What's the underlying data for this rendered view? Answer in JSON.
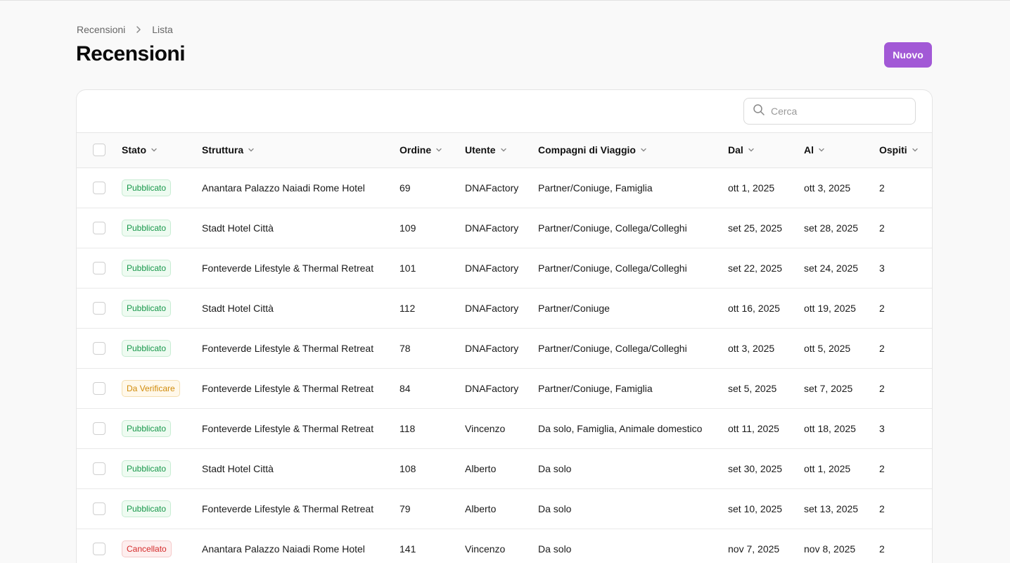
{
  "breadcrumb": {
    "root": "Recensioni",
    "current": "Lista"
  },
  "page": {
    "title": "Recensioni",
    "new_button": "Nuovo"
  },
  "search": {
    "placeholder": "Cerca"
  },
  "colors": {
    "accent": "#a259d6",
    "published": "#17974a",
    "pending": "#d08a0a",
    "cancelled": "#d42a2a"
  },
  "columns": {
    "stato": "Stato",
    "struttura": "Struttura",
    "ordine": "Ordine",
    "utente": "Utente",
    "compagni": "Compagni di Viaggio",
    "dal": "Dal",
    "al": "Al",
    "ospiti": "Ospiti"
  },
  "rows": [
    {
      "stato": "Pubblicato",
      "status": "green",
      "struttura": "Anantara Palazzo Naiadi Rome Hotel",
      "ordine": "69",
      "utente": "DNAFactory",
      "compagni": "Partner/Coniuge, Famiglia",
      "dal": "ott 1, 2025",
      "al": "ott 3, 2025",
      "ospiti": "2"
    },
    {
      "stato": "Pubblicato",
      "status": "green",
      "struttura": "Stadt Hotel Città",
      "ordine": "109",
      "utente": "DNAFactory",
      "compagni": "Partner/Coniuge, Collega/Colleghi",
      "dal": "set 25, 2025",
      "al": "set 28, 2025",
      "ospiti": "2"
    },
    {
      "stato": "Pubblicato",
      "status": "green",
      "struttura": "Fonteverde Lifestyle & Thermal Retreat",
      "ordine": "101",
      "utente": "DNAFactory",
      "compagni": "Partner/Coniuge, Collega/Colleghi",
      "dal": "set 22, 2025",
      "al": "set 24, 2025",
      "ospiti": "3"
    },
    {
      "stato": "Pubblicato",
      "status": "green",
      "struttura": "Stadt Hotel Città",
      "ordine": "112",
      "utente": "DNAFactory",
      "compagni": "Partner/Coniuge",
      "dal": "ott 16, 2025",
      "al": "ott 19, 2025",
      "ospiti": "2"
    },
    {
      "stato": "Pubblicato",
      "status": "green",
      "struttura": "Fonteverde Lifestyle & Thermal Retreat",
      "ordine": "78",
      "utente": "DNAFactory",
      "compagni": "Partner/Coniuge, Collega/Colleghi",
      "dal": "ott 3, 2025",
      "al": "ott 5, 2025",
      "ospiti": "2"
    },
    {
      "stato": "Da Verificare",
      "status": "amber",
      "struttura": "Fonteverde Lifestyle & Thermal Retreat",
      "ordine": "84",
      "utente": "DNAFactory",
      "compagni": "Partner/Coniuge, Famiglia",
      "dal": "set 5, 2025",
      "al": "set 7, 2025",
      "ospiti": "2"
    },
    {
      "stato": "Pubblicato",
      "status": "green",
      "struttura": "Fonteverde Lifestyle & Thermal Retreat",
      "ordine": "118",
      "utente": "Vincenzo",
      "compagni": "Da solo, Famiglia, Animale domestico",
      "dal": "ott 11, 2025",
      "al": "ott 18, 2025",
      "ospiti": "3"
    },
    {
      "stato": "Pubblicato",
      "status": "green",
      "struttura": "Stadt Hotel Città",
      "ordine": "108",
      "utente": "Alberto",
      "compagni": "Da solo",
      "dal": "set 30, 2025",
      "al": "ott 1, 2025",
      "ospiti": "2"
    },
    {
      "stato": "Pubblicato",
      "status": "green",
      "struttura": "Fonteverde Lifestyle & Thermal Retreat",
      "ordine": "79",
      "utente": "Alberto",
      "compagni": "Da solo",
      "dal": "set 10, 2025",
      "al": "set 13, 2025",
      "ospiti": "2"
    },
    {
      "stato": "Cancellato",
      "status": "red",
      "struttura": "Anantara Palazzo Naiadi Rome Hotel",
      "ordine": "141",
      "utente": "Vincenzo",
      "compagni": "Da solo",
      "dal": "nov 7, 2025",
      "al": "nov 8, 2025",
      "ospiti": "2"
    }
  ]
}
